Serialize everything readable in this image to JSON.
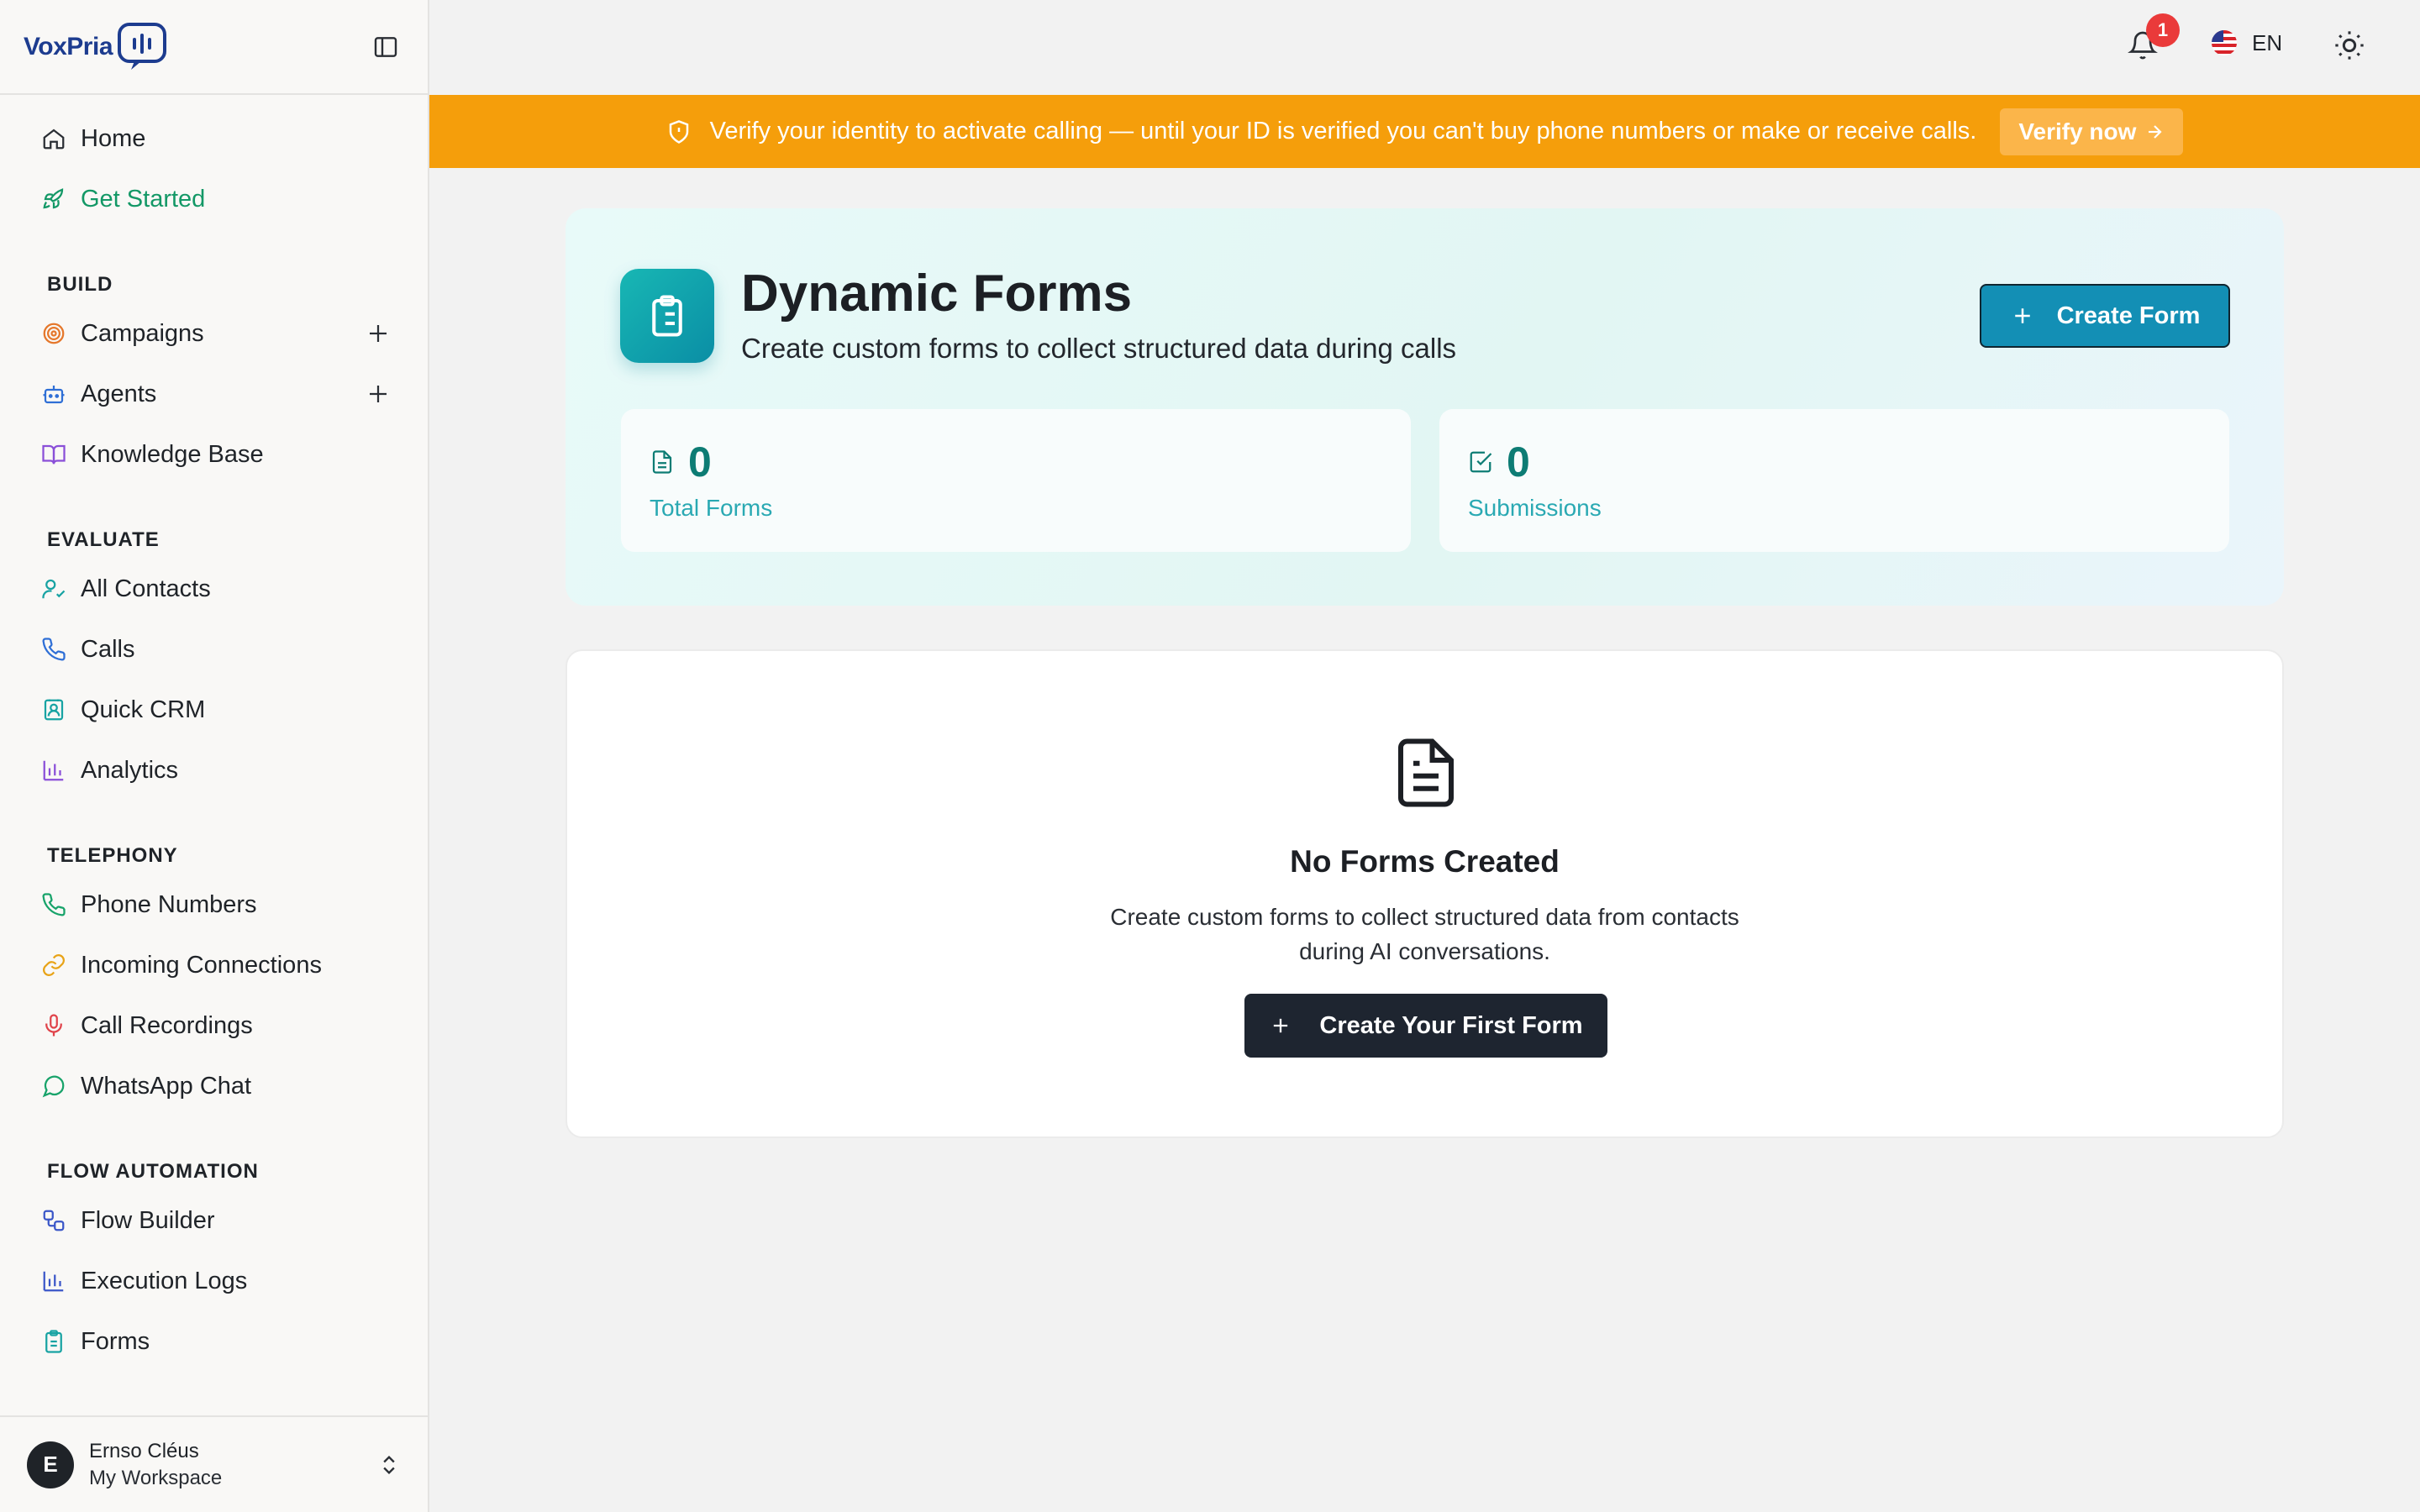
{
  "app": {
    "logo_text": "VoxPria"
  },
  "sidebar": {
    "top_items": [
      {
        "label": "Home",
        "icon": "home-icon"
      },
      {
        "label": "Get Started",
        "icon": "rocket-icon",
        "active": true
      }
    ],
    "sections": [
      {
        "title": "BUILD",
        "items": [
          {
            "label": "Campaigns",
            "icon": "target-icon"
          },
          {
            "label": "Agents",
            "icon": "bot-icon"
          },
          {
            "label": "Knowledge Base",
            "icon": "book-icon"
          }
        ]
      },
      {
        "title": "EVALUATE",
        "items": [
          {
            "label": "All Contacts",
            "icon": "user-check-icon"
          },
          {
            "label": "Calls",
            "icon": "phone-icon"
          },
          {
            "label": "Quick CRM",
            "icon": "contact-card-icon"
          },
          {
            "label": "Analytics",
            "icon": "bar-chart-icon"
          }
        ]
      },
      {
        "title": "TELEPHONY",
        "items": [
          {
            "label": "Phone Numbers",
            "icon": "phone-icon"
          },
          {
            "label": "Incoming Connections",
            "icon": "link-icon"
          },
          {
            "label": "Call Recordings",
            "icon": "mic-icon"
          },
          {
            "label": "WhatsApp Chat",
            "icon": "chat-icon"
          }
        ]
      },
      {
        "title": "FLOW AUTOMATION",
        "items": [
          {
            "label": "Flow Builder",
            "icon": "workflow-icon"
          },
          {
            "label": "Execution Logs",
            "icon": "bar-chart-icon"
          },
          {
            "label": "Forms",
            "icon": "clipboard-icon"
          }
        ]
      }
    ],
    "user": {
      "initial": "E",
      "name": "Ernso Cléus",
      "workspace": "My Workspace"
    }
  },
  "topbar": {
    "notification_count": "1",
    "language": "EN"
  },
  "banner": {
    "message": "Verify your identity to activate calling — until your ID is verified you can't buy phone numbers or make or receive calls.",
    "cta": "Verify now"
  },
  "hero": {
    "title": "Dynamic Forms",
    "subtitle": "Create custom forms to collect structured data during calls",
    "create_button": "Create Form",
    "stats": [
      {
        "value": "0",
        "label": "Total Forms",
        "icon": "file-icon"
      },
      {
        "value": "0",
        "label": "Submissions",
        "icon": "check-square-icon"
      }
    ]
  },
  "empty_state": {
    "title": "No Forms Created",
    "desc_line1": "Create custom forms to collect structured data from contacts",
    "desc_line2": "during AI conversations.",
    "button": "Create Your First Form"
  },
  "colors": {
    "brand": "#1d3c8f",
    "active_nav": "#139866",
    "banner": "#f59e0b",
    "primary_button": "#138fb5",
    "dark_button": "#1e2530",
    "stat_value": "#0d7c74"
  }
}
